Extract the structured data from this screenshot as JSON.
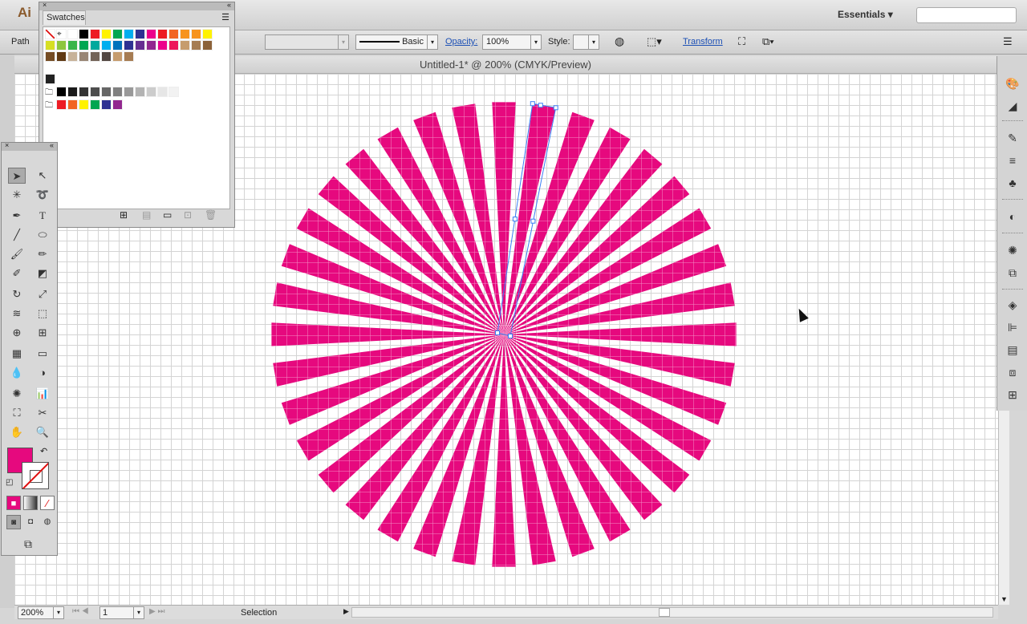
{
  "app": {
    "logo": "Ai",
    "workspace": "Essentials",
    "workspace_arrow": "▾"
  },
  "control": {
    "selection_type": "Path",
    "stroke_style": "Basic",
    "opacity_label": "Opacity:",
    "opacity_value": "100%",
    "style_label": "Style:",
    "transform_label": "Transform"
  },
  "document": {
    "title": "Untitled-1* @ 200% (CMYK/Preview)"
  },
  "swatches_panel": {
    "tab": "Swatches",
    "colors": [
      "#ffffff",
      "#000000",
      "#ed1c24",
      "#fff200",
      "#00a651",
      "#00aeef",
      "#2e3192",
      "#ec008c",
      "#ed1c24",
      "#f26522",
      "#f7941d",
      "#f7941d",
      "#fff200",
      "#d7df23",
      "#8dc63f",
      "#39b54a",
      "#00a651",
      "#00a99d",
      "#00aeef",
      "#0072bc",
      "#2e3192",
      "#662d91",
      "#92278f",
      "#ec008c",
      "#ed145b",
      "#c69c6d",
      "#a67c52",
      "#8c6239",
      "#754c24",
      "#603913",
      "#c7b299",
      "#998675",
      "#736357",
      "#534741",
      "#c69c6d",
      "#a67c52"
    ],
    "grays": [
      "#000000",
      "#1a1a1a",
      "#333333",
      "#4d4d4d",
      "#666666",
      "#808080",
      "#999999",
      "#b3b3b3",
      "#cccccc",
      "#e6e6e6",
      "#f2f2f2"
    ],
    "group2": [
      "#ed1c24",
      "#f26522",
      "#fff200",
      "#00a651",
      "#2e3192",
      "#92278f"
    ]
  },
  "status": {
    "zoom": "200%",
    "page": "1",
    "tool": "Selection"
  },
  "colors": {
    "accent": "#e6097e",
    "fill": "#e6097e"
  },
  "artwork": {
    "rays": 36,
    "selected_ray": 1
  }
}
